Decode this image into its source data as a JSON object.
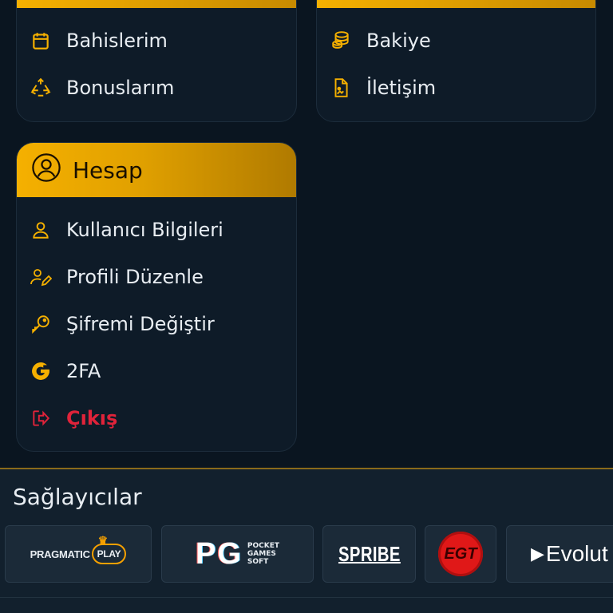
{
  "card_left_top": {
    "items": [
      {
        "label": "Bahislerim",
        "icon": "calendar-icon"
      },
      {
        "label": "Bonuslarım",
        "icon": "recycle-icon"
      }
    ]
  },
  "card_right_top": {
    "items": [
      {
        "label": "Bakiye",
        "icon": "coins-icon"
      },
      {
        "label": "İletişim",
        "icon": "document-icon"
      }
    ]
  },
  "account_card": {
    "title": "Hesap",
    "icon": "user-circle-icon",
    "items": [
      {
        "label": "Kullanıcı Bilgileri",
        "icon": "user-icon"
      },
      {
        "label": "Profili Düzenle",
        "icon": "user-edit-icon"
      },
      {
        "label": "Şifremi Değiştir",
        "icon": "key-icon"
      },
      {
        "label": "2FA",
        "icon": "google-icon"
      },
      {
        "label": "Çıkış",
        "icon": "logout-icon"
      }
    ]
  },
  "providers": {
    "title": "Sağlayıcılar",
    "items": [
      {
        "name": "PRAGMATIC",
        "name2": "PLAY"
      },
      {
        "name": "PG",
        "sub1": "POCKET",
        "sub2": "GAMES",
        "sub3": "SOFT"
      },
      {
        "name": "SPRIBE"
      },
      {
        "name": "EGT"
      },
      {
        "name": "Evolut"
      }
    ]
  },
  "colors": {
    "accent": "#f5b000",
    "background": "#0a1520",
    "card": "#0e1b28",
    "danger": "#e0233a"
  }
}
